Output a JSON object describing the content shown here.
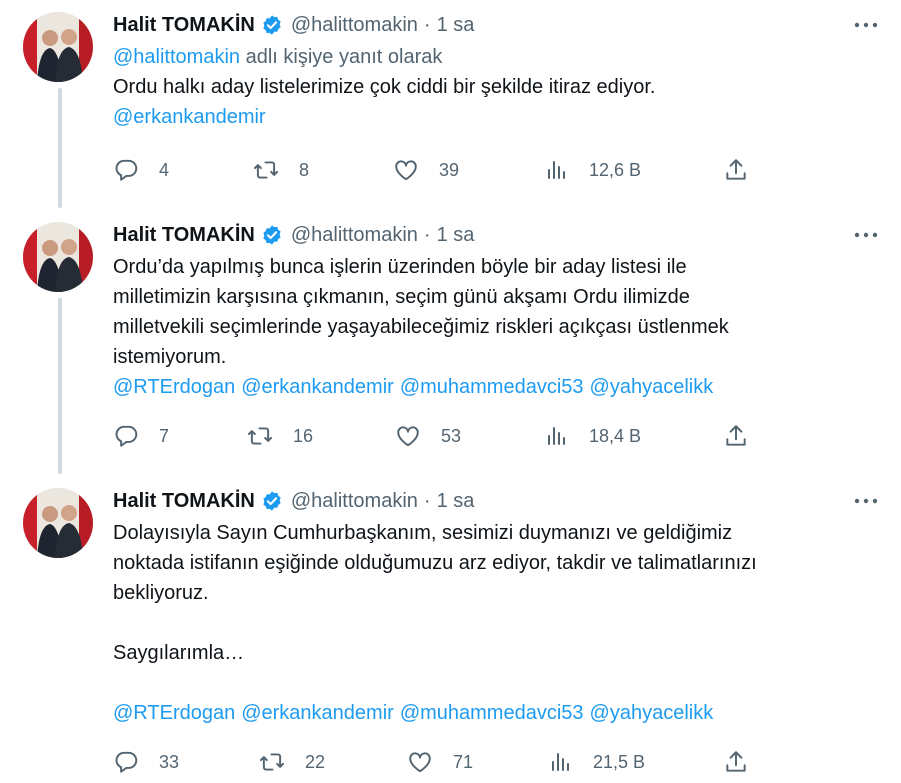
{
  "tweets": [
    {
      "name": "Halit TOMAKİN",
      "handle": "@halittomakin",
      "separator": "·",
      "time": "1 sa",
      "reply_prefix": "@halittomakin",
      "reply_suffix": " adlı kişiye yanıt olarak",
      "text": "Ordu halkı aday listelerimize çok ciddi bir şekilde itiraz ediyor.",
      "mentions": [
        "@erkankandemir"
      ],
      "replies": "4",
      "retweets": "8",
      "likes": "39",
      "views": "12,6 B"
    },
    {
      "name": "Halit TOMAKİN",
      "handle": "@halittomakin",
      "separator": "·",
      "time": "1 sa",
      "text": "Ordu’da yapılmış bunca işlerin üzerinden böyle bir aday listesi ile\nmilletimizin karşısına çıkmanın, seçim günü akşamı Ordu ilimizde\nmilletvekili seçimlerinde yaşayabileceğimiz riskleri açıkçası üstlenmek\nistemiyorum.",
      "mentions": [
        "@RTErdogan",
        "@erkankandemir",
        "@muhammedavci53",
        "@yahyacelikk"
      ],
      "replies": "7",
      "retweets": "16",
      "likes": "53",
      "views": "18,4 B"
    },
    {
      "name": "Halit TOMAKİN",
      "handle": "@halittomakin",
      "separator": "·",
      "time": "1 sa",
      "text": "Dolayısıyla Sayın Cumhurbaşkanım, sesimizi duymanızı ve geldiğimiz\nnoktada istifanın eşiğinde olduğumuzu arz ediyor, takdir ve talimatlarınızı\nbekliyoruz.\n\nSaygılarımla…",
      "mentions": [
        "@RTErdogan",
        "@erkankandemir",
        "@muhammedavci53",
        "@yahyacelikk"
      ],
      "replies": "33",
      "retweets": "22",
      "likes": "71",
      "views": "21,5 B"
    }
  ],
  "colors": {
    "link": "#1d9bf0",
    "secondary": "#536471",
    "text": "#0f1419",
    "thread_line": "#cfd9de",
    "verified": "#1d9bf0"
  },
  "icons": {
    "verified": "verified-badge-icon",
    "more": "more-horizontal-icon",
    "reply": "reply-icon",
    "retweet": "retweet-icon",
    "like": "heart-icon",
    "views": "views-analytics-icon",
    "share": "share-icon"
  }
}
